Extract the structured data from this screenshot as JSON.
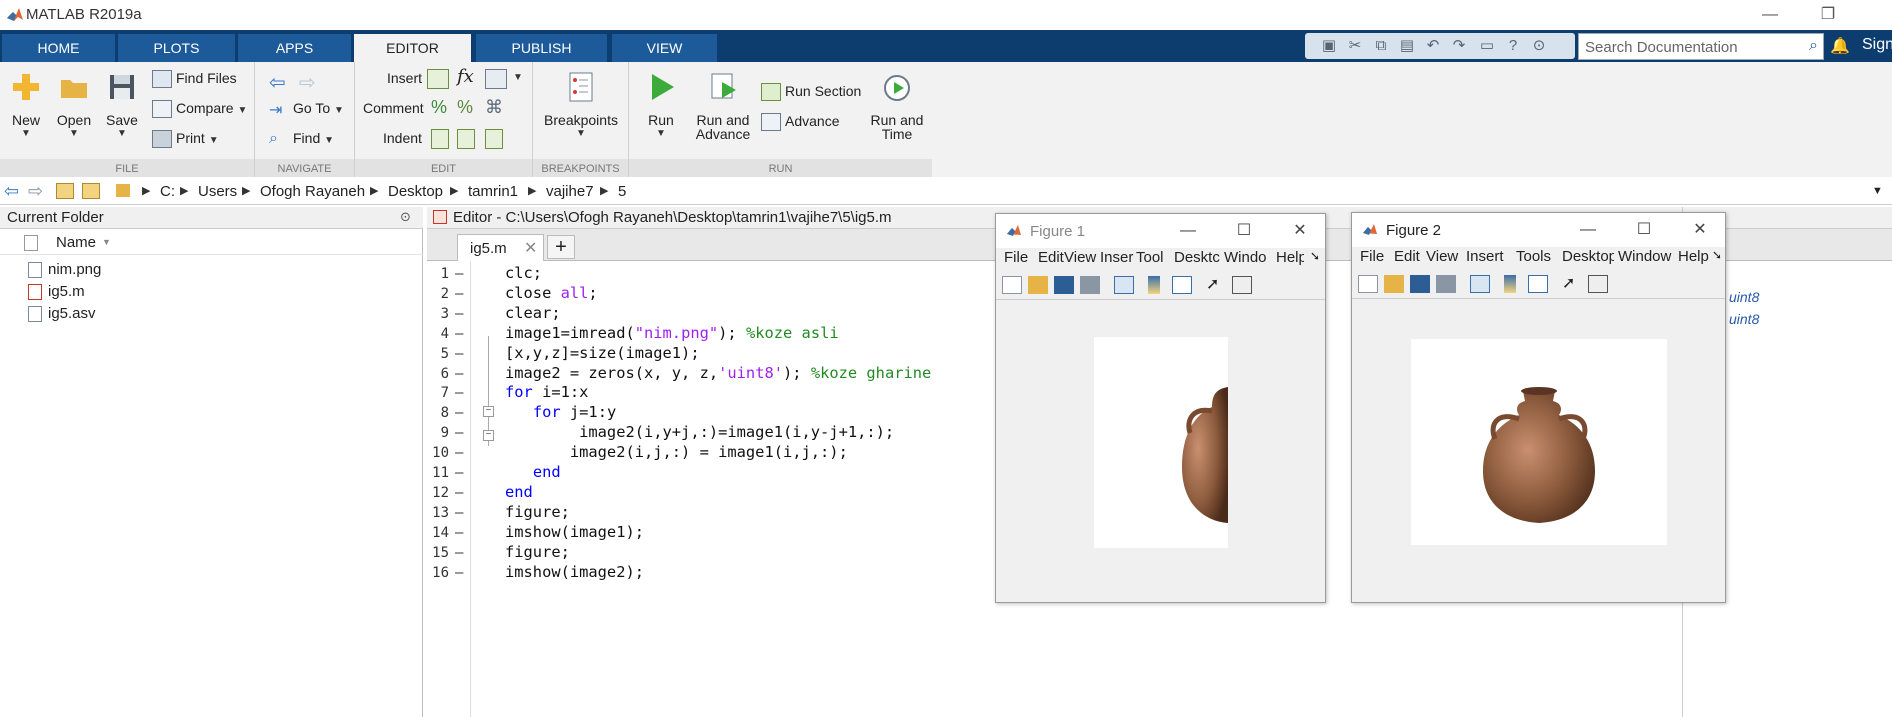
{
  "app": {
    "title": "MATLAB R2019a"
  },
  "window_controls": {
    "minimize": "—",
    "restore": "❐"
  },
  "tabs": [
    {
      "label": "HOME"
    },
    {
      "label": "PLOTS"
    },
    {
      "label": "APPS"
    },
    {
      "label": "EDITOR"
    },
    {
      "label": "PUBLISH"
    },
    {
      "label": "VIEW"
    }
  ],
  "search": {
    "placeholder": "Search Documentation",
    "signin": "Sign"
  },
  "ribbon": {
    "file": {
      "label": "FILE",
      "new": "New",
      "open": "Open",
      "save": "Save",
      "find_files": "Find Files",
      "compare": "Compare",
      "print": "Print"
    },
    "navigate": {
      "label": "NAVIGATE",
      "go_to": "Go To",
      "find": "Find"
    },
    "edit": {
      "label": "EDIT",
      "insert": "Insert",
      "comment": "Comment",
      "indent": "Indent",
      "fx": "fx"
    },
    "breakpoints": {
      "label": "BREAKPOINTS",
      "breakpoints": "Breakpoints"
    },
    "run": {
      "label": "RUN",
      "run": "Run",
      "run_and_advance_1": "Run and",
      "run_and_advance_2": "Advance",
      "run_section": "Run Section",
      "advance": "Advance",
      "run_and_time_1": "Run and",
      "run_and_time_2": "Time"
    }
  },
  "address": {
    "path": [
      "C:",
      "Users",
      "Ofogh Rayaneh",
      "Desktop",
      "tamrin1",
      "vajihe7",
      "5"
    ]
  },
  "current_folder": {
    "title": "Current Folder",
    "column_name": "Name",
    "files": [
      {
        "name": "nim.png"
      },
      {
        "name": "ig5.m"
      },
      {
        "name": "ig5.asv"
      }
    ]
  },
  "editor": {
    "title": "Editor - C:\\Users\\Ofogh Rayaneh\\Desktop\\tamrin1\\vajihe7\\5\\ig5.m",
    "tab": "ig5.m",
    "close": "✕",
    "add": "+",
    "lines": [
      {
        "n": "1",
        "text": "clc;"
      },
      {
        "n": "2",
        "pre": "close ",
        "str": "all",
        "post": ";"
      },
      {
        "n": "3",
        "text": "clear;"
      },
      {
        "n": "4",
        "pre": "image1=imread(",
        "str": "\"nim.png\"",
        "post": "); ",
        "cm": "%koze asli"
      },
      {
        "n": "5",
        "text": "[x,y,z]=size(image1);"
      },
      {
        "n": "6",
        "pre": "image2 = zeros(x, y, z,",
        "str": "'uint8'",
        "post": "); ",
        "cm": "%koze gharine"
      },
      {
        "n": "7",
        "kw": "for",
        "post": " i=1:x"
      },
      {
        "n": "8",
        "indent": "   ",
        "kw": "for",
        "post": " j=1:y"
      },
      {
        "n": "9",
        "text": "        image2(i,y+j,:)=image1(i,y-j+1,:);"
      },
      {
        "n": "10",
        "text": "       image2(i,j,:) = image1(i,j,:);"
      },
      {
        "n": "11",
        "indent": "   ",
        "kw": "end"
      },
      {
        "n": "12",
        "kw": "end"
      },
      {
        "n": "13",
        "text": "figure;"
      },
      {
        "n": "14",
        "text": "imshow(image1);"
      },
      {
        "n": "15",
        "text": "figure;"
      },
      {
        "n": "16",
        "text": "imshow(image2);"
      }
    ],
    "dash": "–"
  },
  "workspace": {
    "values": [
      "uint8",
      "uint8"
    ]
  },
  "figure1": {
    "title": "Figure 1",
    "menu": [
      "File",
      "Edit",
      "View",
      "Inser",
      "Tool",
      "Desktc",
      "Windo",
      "Help"
    ],
    "more": "➘"
  },
  "figure2": {
    "title": "Figure 2",
    "menu": [
      "File",
      "Edit",
      "View",
      "Insert",
      "Tools",
      "Desktop",
      "Window",
      "Help"
    ],
    "more": "➘"
  },
  "colors": {
    "accent": "#0d3c6e",
    "tab": "#1d5a99",
    "keyword": "#0000ff",
    "string": "#a020f0",
    "comment": "#228b22",
    "vase": "#8b5a3c"
  }
}
